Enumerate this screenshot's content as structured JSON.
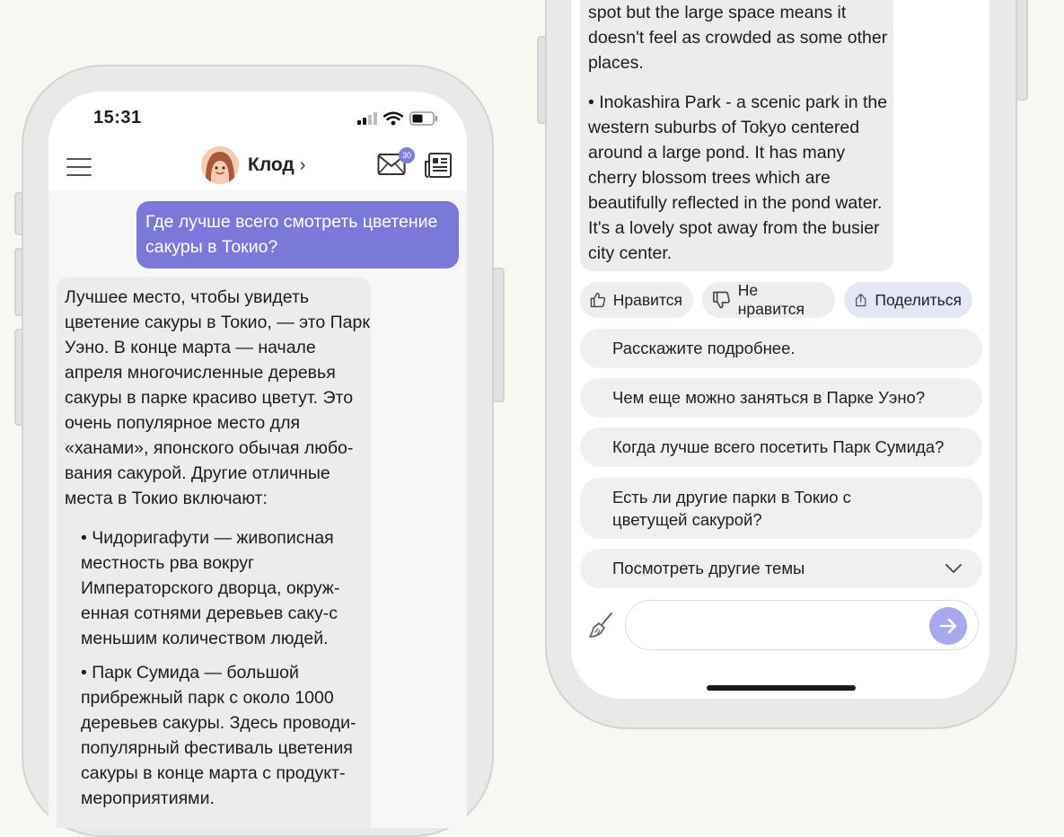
{
  "left_phone": {
    "status_bar": {
      "time": "15:31"
    },
    "header": {
      "bot_name": "Клод",
      "chevron": "›",
      "mail_badge_count": "30",
      "icons": [
        "menu-icon",
        "avatar",
        "mail-icon",
        "news-icon"
      ]
    },
    "chat": {
      "user_message": "Где лучше всего смотреть цветение сакуры в Токио?",
      "bot_intro": "Лучшее место, чтобы увидеть цветение сакуры в Токио, — это Парк Уэно. В конце марта — начале апреля многочисленные деревья сакуры в парке красиво цветут. Это очень популярное место для «ханами», японского обычая любо-вания сакурой. Другие отличные места в Токио включают:",
      "bullet_1": "• Чидоригафути — живописная местность рва вокруг Императорского дворца, окруж-енная сотнями деревьев саку-с меньшим количеством людей.",
      "bullet_2": "• Парк Сумида — большой прибрежный парк с около 1000 деревьев сакуры. Здесь проводи-популярный фестиваль цветения сакуры в конце марта с продукт-мероприятиями."
    }
  },
  "right_phone": {
    "chat": {
      "continued_text": "spot but the large space means it doesn't feel as crowded as some other places.",
      "bullet_inokashira": "• Inokashira Park - a scenic park in the western suburbs of Tokyo centered around a large pond. It has many cherry blossom trees which are beautifully reflected in the pond water. It's a lovely spot away from the busier city center."
    },
    "reactions": {
      "like": "Нравится",
      "dislike": "Не нравится",
      "share": "Поделиться"
    },
    "suggestions": [
      "Расскажите подробнее.",
      "Чем еще можно заняться в Парке Уэно?",
      "Когда лучше всего посетить Парк Сумида?",
      "Есть ли другие парки в Токио с цветущей сакурой?",
      "Посмотреть другие темы"
    ],
    "composer": {
      "placeholder": "",
      "icons": [
        "broom-icon",
        "send-arrow-icon"
      ]
    }
  },
  "colors": {
    "accent": "#7a79d9",
    "send_button": "#a8a8ec",
    "badge": "#7b7fd8",
    "bubble_gray": "#ececec"
  }
}
